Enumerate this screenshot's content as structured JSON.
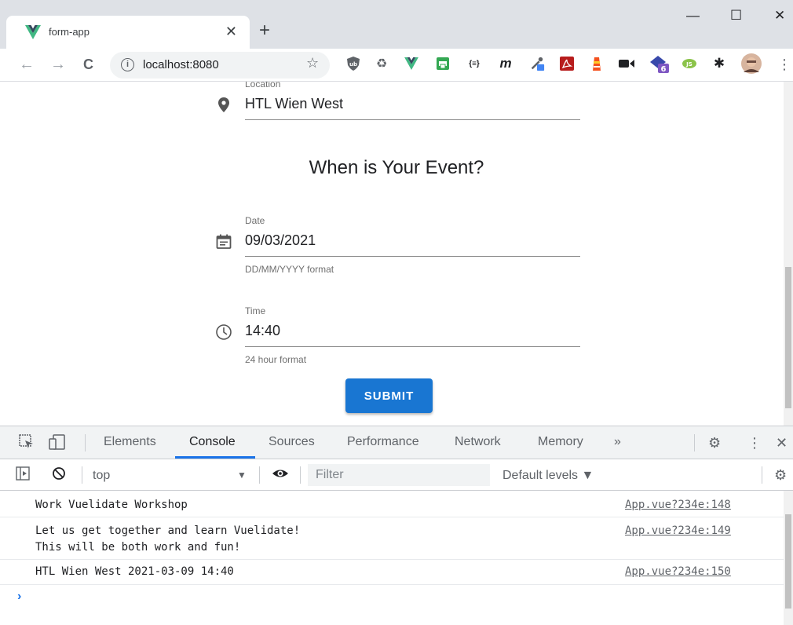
{
  "browser": {
    "tab_title": "form-app",
    "tab_close": "✕",
    "new_tab": "+",
    "url": "localhost:8080",
    "window_controls": {
      "minimize": "—",
      "maximize": "☐",
      "close": "✕"
    },
    "nav": {
      "back": "←",
      "forward": "→",
      "reload": "C"
    },
    "icons": [
      "vue-icon",
      "info-icon",
      "star-icon",
      "ublock-icon",
      "recycle-icon",
      "vue-devtools-icon",
      "printer-icon",
      "json-icon",
      "m-icon",
      "eyedropper-icon",
      "pdf-icon",
      "lighthouse-icon",
      "camera-icon",
      "extension-badge-icon",
      "js-icon",
      "puzzle-icon",
      "profile-avatar",
      "kebab-menu-icon"
    ],
    "ext_labels": {
      "json": "{≡}",
      "m": "m",
      "badge": "6",
      "js": "JS"
    },
    "accent_vue": "#42b883"
  },
  "page": {
    "location": {
      "label": "Location",
      "value": "HTL Wien West"
    },
    "section_title": "When is Your Event?",
    "date": {
      "label": "Date",
      "value": "09/03/2021",
      "hint": "DD/MM/YYYY format"
    },
    "time": {
      "label": "Time",
      "value": "14:40",
      "hint": "24 hour format"
    },
    "submit_label": "SUBMIT",
    "submit_color": "#1976d2"
  },
  "devtools": {
    "tabs": [
      {
        "label": "Elements",
        "active": false
      },
      {
        "label": "Console",
        "active": true
      },
      {
        "label": "Sources",
        "active": false
      },
      {
        "label": "Performance",
        "active": false
      },
      {
        "label": "Network",
        "active": false
      },
      {
        "label": "Memory",
        "active": false
      }
    ],
    "more_tabs": "»",
    "close": "✕",
    "context": "top",
    "filter_placeholder": "Filter",
    "levels": "Default levels ▼",
    "logs": [
      {
        "message": "Work Vuelidate Workshop",
        "source": "App.vue?234e:148"
      },
      {
        "message": "Let us get together and learn Vuelidate!\nThis will be both work and fun!",
        "source": "App.vue?234e:149"
      },
      {
        "message": "HTL Wien West 2021-03-09 14:40",
        "source": "App.vue?234e:150"
      }
    ],
    "prompt": "›"
  }
}
